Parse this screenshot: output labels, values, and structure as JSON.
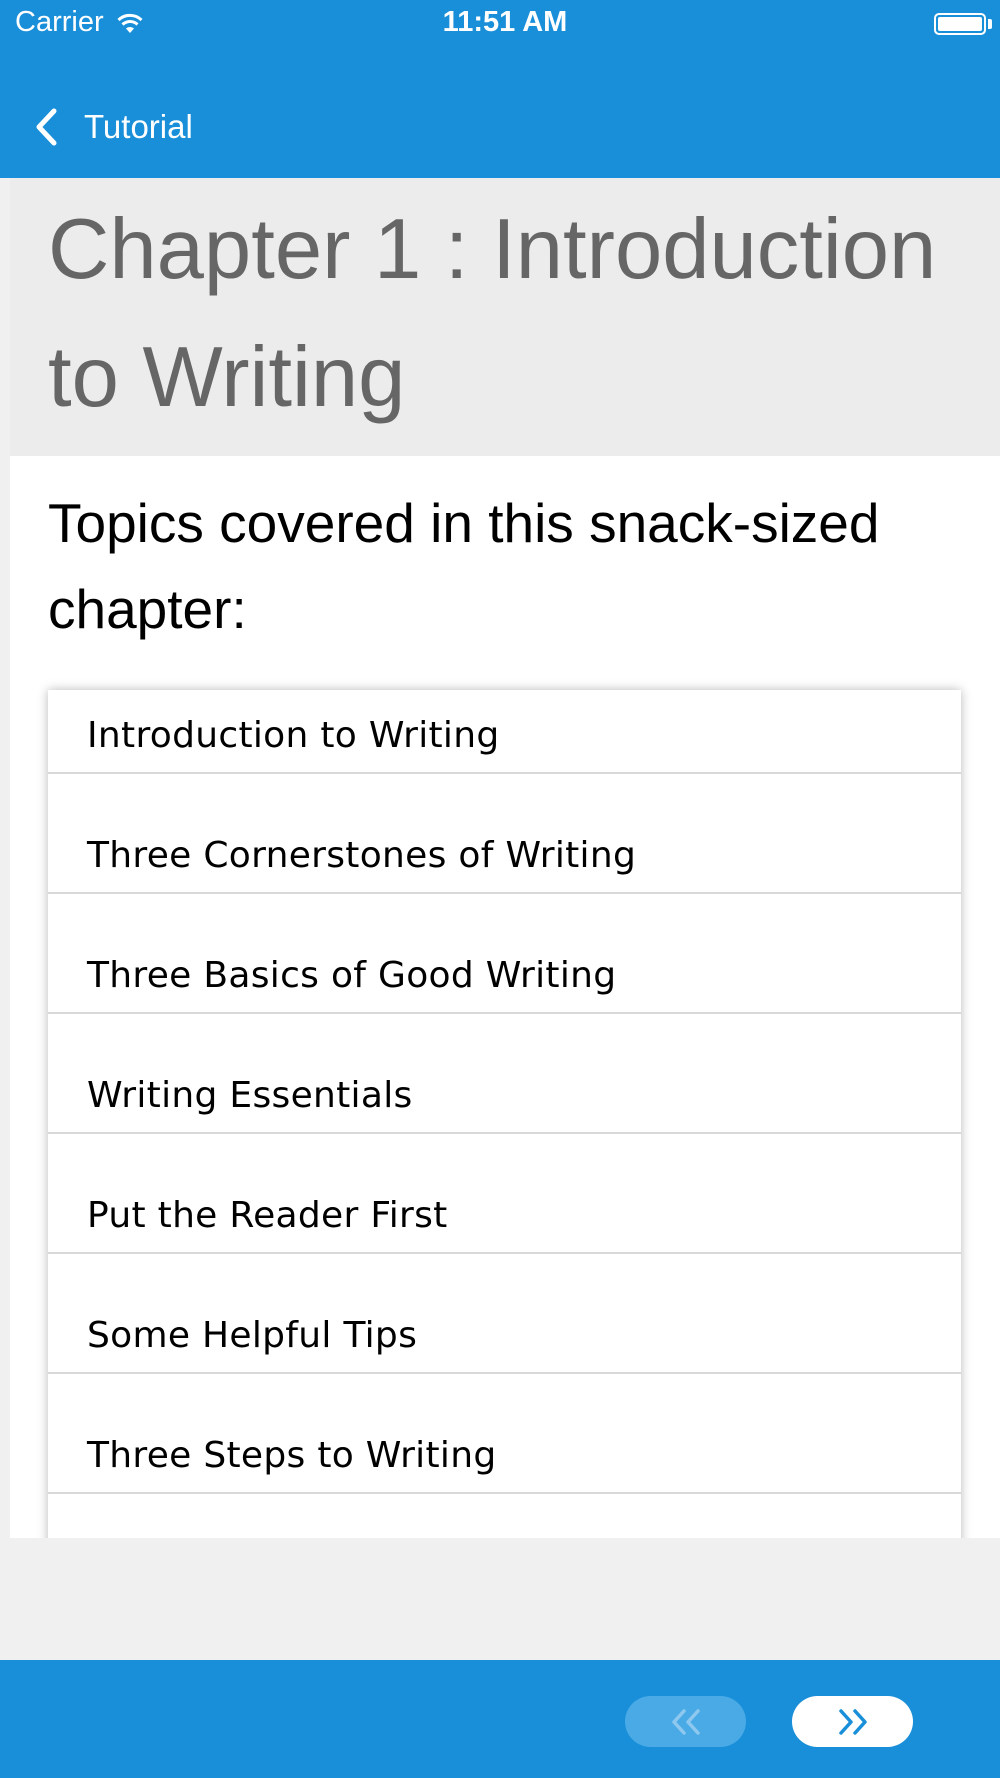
{
  "status_bar": {
    "carrier": "Carrier",
    "time": "11:51 AM"
  },
  "nav": {
    "back_label": "Tutorial"
  },
  "chapter": {
    "title": "Chapter 1 : Introduction to Writing"
  },
  "topics": {
    "heading": "Topics covered in this snack-sized chapter:",
    "items": [
      {
        "label": "Introduction to Writing"
      },
      {
        "label": "Three Cornerstones of Writing"
      },
      {
        "label": "Three Basics of Good Writing"
      },
      {
        "label": "Writing Essentials"
      },
      {
        "label": "Put the Reader First"
      },
      {
        "label": "Some Helpful Tips"
      },
      {
        "label": "Three Steps to Writing"
      },
      {
        "label": ""
      }
    ]
  },
  "bottom_nav": {
    "prev_icon": "double-chevron-left-icon",
    "next_icon": "double-chevron-right-icon",
    "prev_enabled": false,
    "next_enabled": true
  },
  "colors": {
    "brand_blue": "#1a8fd9",
    "title_gray": "#666666",
    "title_bg": "#ececec",
    "disabled_button": "#49aae6"
  }
}
